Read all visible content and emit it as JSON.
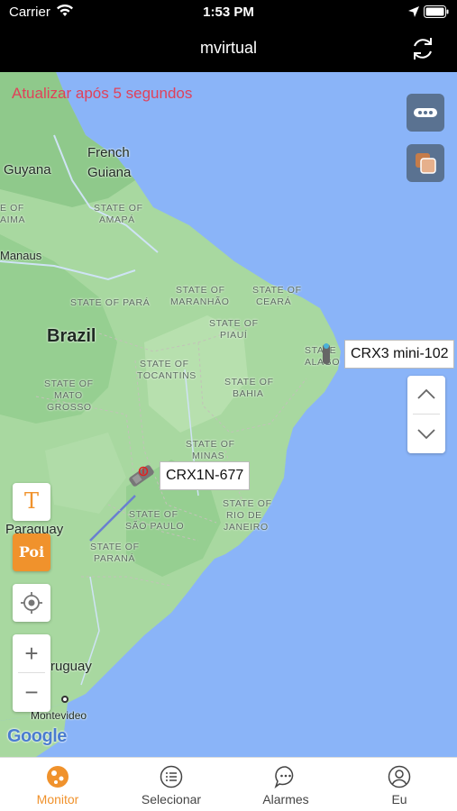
{
  "status_bar": {
    "carrier": "Carrier",
    "time": "1:53 PM"
  },
  "nav": {
    "title": "mvirtual"
  },
  "map": {
    "refresh_notice": "Atualizar após 5 segundos",
    "labels": {
      "guyana": "Guyana",
      "french_guiana_1": "French",
      "french_guiana_2": "Guiana",
      "state_of_amapa_1": "STATE OF",
      "state_of_amapa_2": "AMAPÁ",
      "state_edge_1": "E OF",
      "state_edge_2": "AIMA",
      "manaus": "Manaus",
      "state_para": "STATE OF PARÁ",
      "state_maranhao_1": "STATE OF",
      "state_maranhao_2": "MARANHÃO",
      "state_ceara_1": "STATE OF",
      "state_ceara_2": "CEARÁ",
      "state_piaui_1": "STATE OF",
      "state_piaui_2": "PIAUÍ",
      "brazil": "Brazil",
      "state_tocantins_1": "STATE OF",
      "state_tocantins_2": "TOCANTINS",
      "state_alagoas_1": "STATE",
      "state_alagoas_2": "ALAGO",
      "state_mato_grosso_1": "STATE OF",
      "state_mato_grosso_2": "MATO",
      "state_mato_grosso_3": "GROSSO",
      "state_bahia_1": "STATE OF",
      "state_bahia_2": "BAHIA",
      "state_minas_1": "STATE OF",
      "state_minas_2": "MINAS",
      "paraguay": "Paraguay",
      "state_sao_paulo_1": "STATE OF",
      "state_sao_paulo_2": "SÃO PAULO",
      "state_rio_1": "STATE OF",
      "state_rio_2": "RIO DE",
      "state_rio_3": "JANEIRO",
      "state_parana_1": "STATE OF",
      "state_parana_2": "PARANÁ",
      "uruguay": "ruguay",
      "montevideo": "Montevideo",
      "google": "Google"
    },
    "vehicles": [
      {
        "name": "CRX3 mini-102"
      },
      {
        "name": "CRX1N-677"
      }
    ],
    "text_tool_glyph": "T",
    "poi_label": "Poi",
    "zoom_in_glyph": "+",
    "zoom_out_glyph": "−",
    "colors": {
      "water": "#8ab4f8",
      "land": "#a8d8a0",
      "land_dark": "#8fc98b",
      "notice": "#e0415a"
    }
  },
  "tabs": [
    {
      "label": "Monitor",
      "icon": "monitor-icon",
      "active": true
    },
    {
      "label": "Selecionar",
      "icon": "list-icon",
      "active": false
    },
    {
      "label": "Alarmes",
      "icon": "chat-icon",
      "active": false
    },
    {
      "label": "Eu",
      "icon": "person-icon",
      "active": false
    }
  ]
}
